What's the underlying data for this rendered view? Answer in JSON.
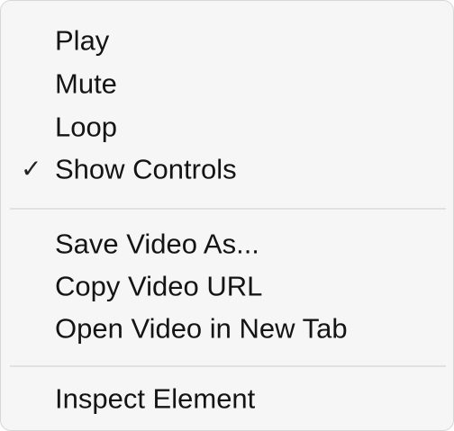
{
  "context_menu": {
    "items": [
      {
        "label": "Play",
        "checked": false
      },
      {
        "label": "Mute",
        "checked": false
      },
      {
        "label": "Loop",
        "checked": false
      },
      {
        "label": "Show Controls",
        "checked": true
      }
    ],
    "check_glyph": "✓",
    "actions": [
      {
        "label": "Save Video As..."
      },
      {
        "label": "Copy Video URL"
      },
      {
        "label": "Open Video in New Tab"
      }
    ],
    "developer": [
      {
        "label": "Inspect Element"
      }
    ]
  }
}
